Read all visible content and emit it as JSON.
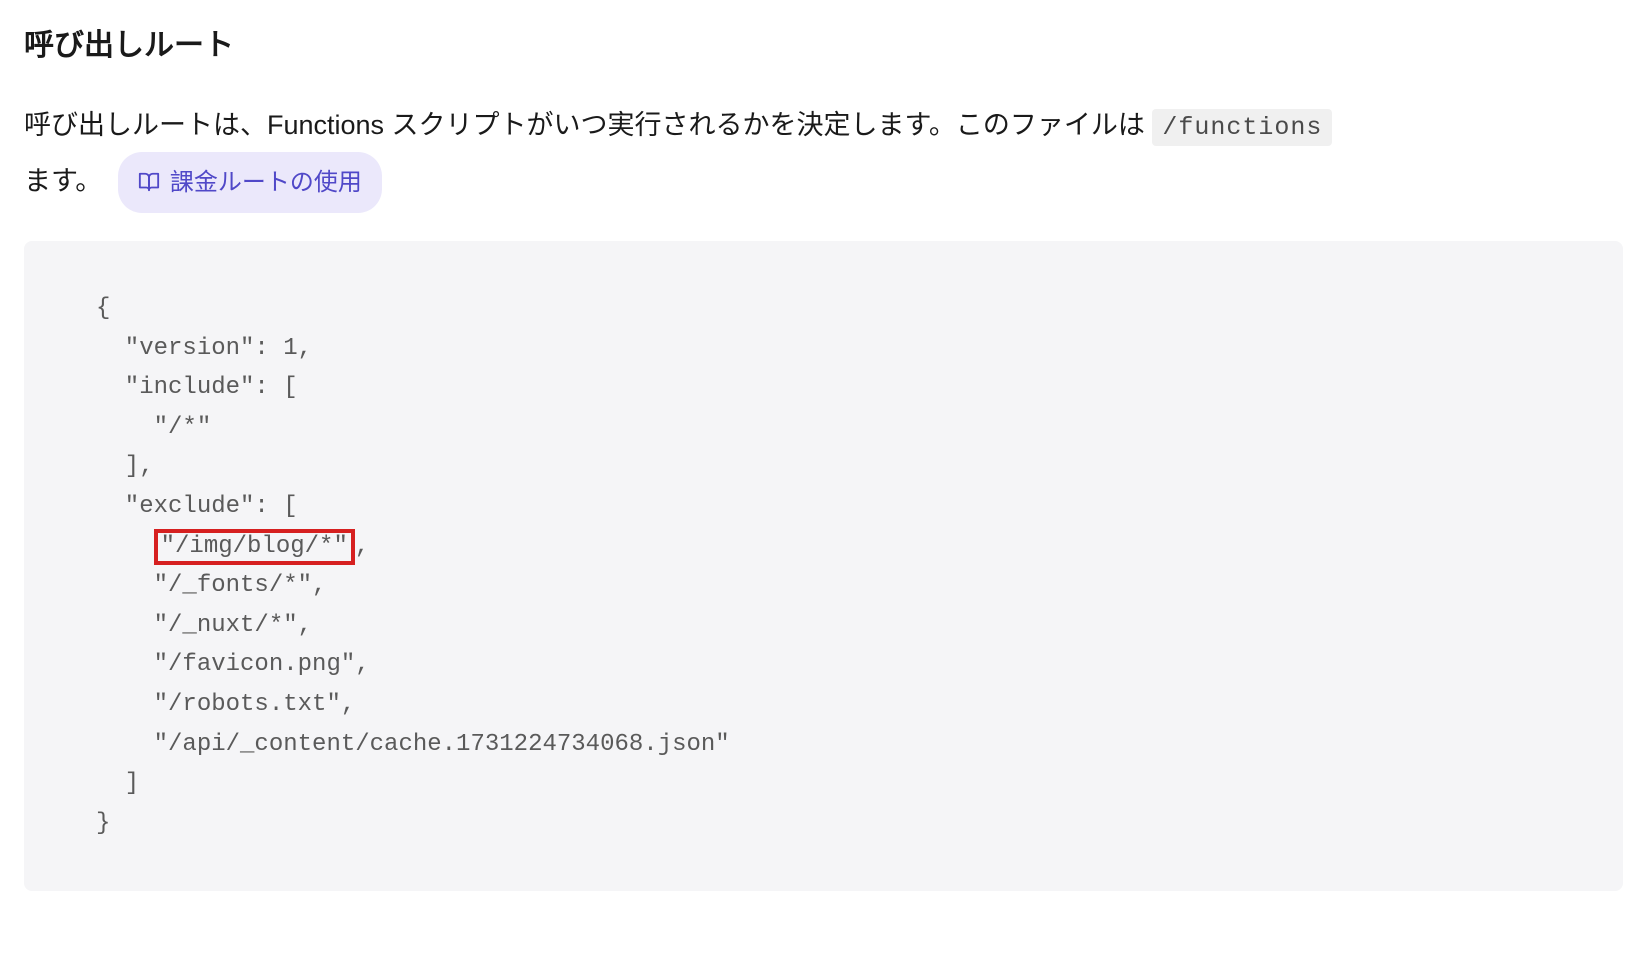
{
  "heading": "呼び出しルート",
  "description": {
    "part1": "呼び出しルートは、Functions スクリプトがいつ実行されるかを決定します。このファイルは ",
    "code": "/functions",
    "part2": "ます。"
  },
  "link": {
    "label": "課金ルートの使用"
  },
  "code": {
    "line1": "{",
    "line2": "  \"version\": 1,",
    "line3": "  \"include\": [",
    "line4": "    \"/*\"",
    "line5": "  ],",
    "line6": "  \"exclude\": [",
    "line7_highlighted": "\"/img/blog/*\"",
    "line7_suffix": ",",
    "line8": "    \"/_fonts/*\",",
    "line9": "    \"/_nuxt/*\",",
    "line10": "    \"/favicon.png\",",
    "line11": "    \"/robots.txt\",",
    "line12": "    \"/api/_content/cache.1731224734068.json\"",
    "line13": "  ]",
    "line14": "}"
  }
}
